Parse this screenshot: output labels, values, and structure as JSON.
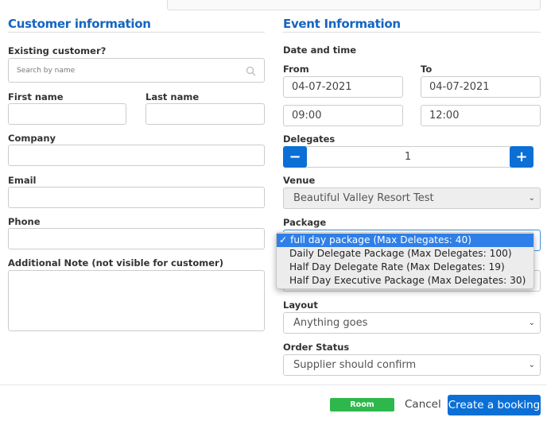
{
  "customer": {
    "title": "Customer information",
    "existing_label": "Existing customer?",
    "search_placeholder": "Search by name",
    "first_name_label": "First name",
    "last_name_label": "Last name",
    "company_label": "Company",
    "email_label": "Email",
    "phone_label": "Phone",
    "note_label": "Additional Note (not visible for customer)"
  },
  "event": {
    "title": "Event Information",
    "datetime_label": "Date and time",
    "from_label": "From",
    "to_label": "To",
    "from_date": "04-07-2021",
    "to_date": "04-07-2021",
    "from_time": "09:00",
    "to_time": "12:00",
    "delegates_label": "Delegates",
    "delegates_value": "1",
    "minus": "−",
    "plus": "+",
    "venue_label": "Venue",
    "venue_value": "Beautiful Valley Resort Test",
    "package_label": "Package",
    "package_options": [
      "full day package (Max Delegates: 40)",
      "Daily Delegate Package (Max Delegates: 100)",
      "Half Day Delegate Rate (Max Delegates: 19)",
      "Half Day Executive Package (Max Delegates: 30)"
    ],
    "checkmark": "✓",
    "layout_label": "Layout",
    "layout_value": "Anything goes",
    "status_label": "Order Status",
    "status_value": "Supplier should confirm"
  },
  "footer": {
    "badge": "Room available",
    "cancel": "Cancel",
    "create": "Create a booking",
    "badge_color": "#2eb84b",
    "primary_color": "#0b6fd6"
  }
}
